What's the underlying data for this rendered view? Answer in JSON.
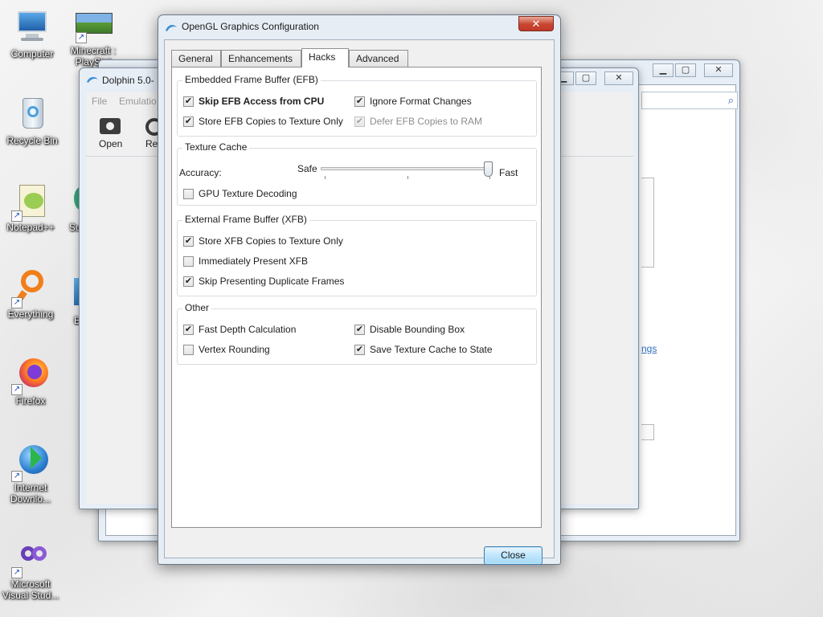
{
  "desktop": {
    "icons": [
      {
        "label": "Computer",
        "icon": "computer-icon"
      },
      {
        "label": "Minecraft : PlayStat",
        "icon": "minecraft-icon"
      },
      {
        "label": "Recycle Bin",
        "icon": "recycle-bin-icon"
      },
      {
        "label": "Notepad++",
        "icon": "notepad-plus-plus-icon"
      },
      {
        "label": "Su",
        "icon": "app-icon"
      },
      {
        "label": "Everything",
        "icon": "everything-icon"
      },
      {
        "label": "E",
        "icon": "app-icon"
      },
      {
        "label": "Firefox",
        "icon": "firefox-icon"
      },
      {
        "label": "Internet Downlo...",
        "icon": "internet-download-manager-icon"
      },
      {
        "label": "Microsoft Visual Stud...",
        "icon": "visual-studio-icon"
      }
    ]
  },
  "dolphin_window": {
    "title": "Dolphin 5.0-",
    "menu": [
      "File",
      "Emulatio"
    ],
    "toolbar": [
      "Open",
      "Refr"
    ]
  },
  "back_window": {
    "link_fragment": "ngs"
  },
  "dialog": {
    "title": "OpenGL Graphics Configuration",
    "tabs": [
      "General",
      "Enhancements",
      "Hacks",
      "Advanced"
    ],
    "active_tab": "Hacks",
    "efb": {
      "title": "Embedded Frame Buffer (EFB)",
      "skip_efb": {
        "label": "Skip EFB Access from CPU",
        "checked": true
      },
      "ignore_format": {
        "label": "Ignore Format Changes",
        "checked": true
      },
      "store_efb": {
        "label": "Store EFB Copies to Texture Only",
        "checked": true
      },
      "defer_efb": {
        "label": "Defer EFB Copies to RAM",
        "checked": true,
        "enabled": false
      }
    },
    "texture_cache": {
      "title": "Texture Cache",
      "accuracy_label": "Accuracy:",
      "safe_label": "Safe",
      "fast_label": "Fast",
      "accuracy_level": 1.0,
      "gpu_decoding": {
        "label": "GPU Texture Decoding",
        "checked": false
      }
    },
    "xfb": {
      "title": "External Frame Buffer (XFB)",
      "store_xfb": {
        "label": "Store XFB Copies to Texture Only",
        "checked": true
      },
      "present_xfb": {
        "label": "Immediately Present XFB",
        "checked": false
      },
      "skip_dup": {
        "label": "Skip Presenting Duplicate Frames",
        "checked": true
      }
    },
    "other": {
      "title": "Other",
      "fast_depth": {
        "label": "Fast Depth Calculation",
        "checked": true
      },
      "disable_bbox": {
        "label": "Disable Bounding Box",
        "checked": true
      },
      "vertex_rounding": {
        "label": "Vertex Rounding",
        "checked": false
      },
      "save_texture_cache": {
        "label": "Save Texture Cache to State",
        "checked": true
      }
    },
    "close_button": "Close",
    "close_glyph": "✕"
  }
}
